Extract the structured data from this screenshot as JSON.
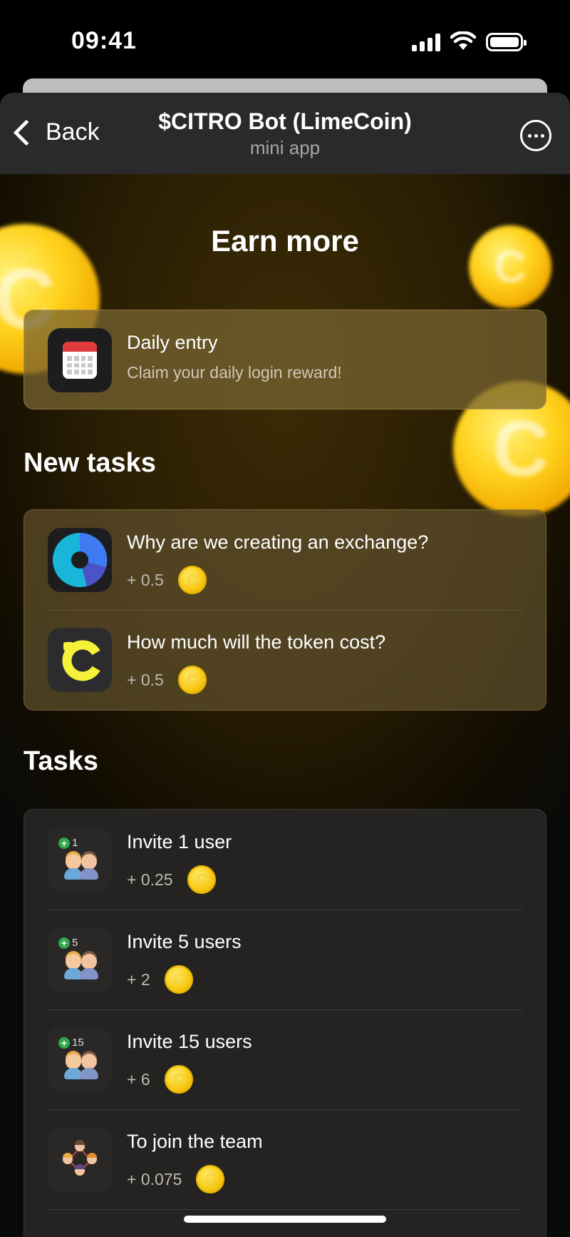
{
  "status_bar": {
    "time": "09:41"
  },
  "header": {
    "back_label": "Back",
    "title": "$CITRO Bot (LimeCoin)",
    "subtitle": "mini app"
  },
  "page": {
    "title": "Earn more"
  },
  "daily": {
    "title": "Daily entry",
    "subtitle": "Claim your daily login reward!"
  },
  "new_tasks": {
    "heading": "New tasks",
    "items": [
      {
        "title": "Why are we creating an exchange?",
        "reward": "+ 0.5",
        "icon": "pie-chart-icon"
      },
      {
        "title": "How much will the token cost?",
        "reward": "+ 0.5",
        "icon": "citro-logo-icon"
      }
    ]
  },
  "tasks": {
    "heading": "Tasks",
    "items": [
      {
        "title": "Invite 1 user",
        "reward": "+ 0.25",
        "badge": "1",
        "icon": "invite-users-icon"
      },
      {
        "title": "Invite 5 users",
        "reward": "+ 2",
        "badge": "5",
        "icon": "invite-users-icon"
      },
      {
        "title": "Invite 15 users",
        "reward": "+ 6",
        "badge": "15",
        "icon": "invite-users-icon"
      },
      {
        "title": "To join the team",
        "reward": "+ 0.075",
        "icon": "team-icon"
      }
    ]
  },
  "colors": {
    "accent": "#f8c813",
    "card_dark": "#252321",
    "header_bg": "#2a2a2a"
  }
}
